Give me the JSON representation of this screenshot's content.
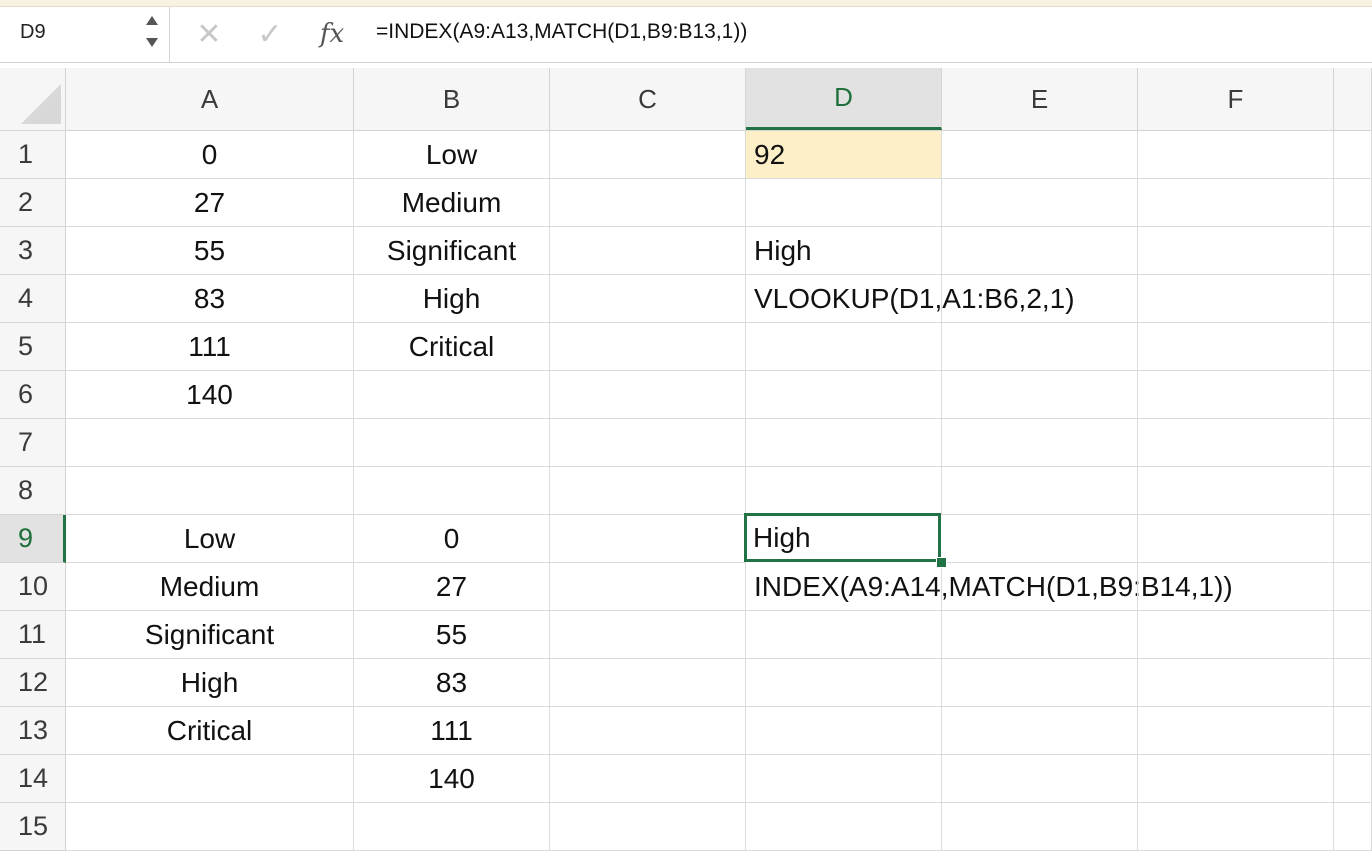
{
  "name_box": {
    "value": "D9"
  },
  "formula_bar": {
    "cancel_icon": "cancel-x-icon",
    "enter_icon": "checkmark-icon",
    "fx_label": "fx",
    "formula": "=INDEX(A9:A13,MATCH(D1,B9:B13,1))"
  },
  "columns": [
    "A",
    "B",
    "C",
    "D",
    "E",
    "F"
  ],
  "rows": [
    "1",
    "2",
    "3",
    "4",
    "5",
    "6",
    "7",
    "8",
    "9",
    "10",
    "11",
    "12",
    "13",
    "14",
    "15"
  ],
  "cells": {
    "A1": "0",
    "B1": "Low",
    "D1": "92",
    "A2": "27",
    "B2": "Medium",
    "A3": "55",
    "B3": "Significant",
    "D3": "High",
    "A4": "83",
    "B4": "High",
    "D4": "VLOOKUP(D1,A1:B6,2,1)",
    "A5": "111",
    "B5": "Critical",
    "A6": "140",
    "A9": "Low",
    "B9": "0",
    "D9": "High",
    "A10": "Medium",
    "B10": "27",
    "D10": "INDEX(A9:A14,MATCH(D1,B9:B14,1))",
    "A11": "Significant",
    "B11": "55",
    "A12": "High",
    "B12": "83",
    "A13": "Critical",
    "B13": "111",
    "B14": "140"
  },
  "selection": {
    "active_cell": "D9",
    "highlight_cell": "D1",
    "highlight_color": "#fdefc8",
    "accent_color": "#217346"
  }
}
